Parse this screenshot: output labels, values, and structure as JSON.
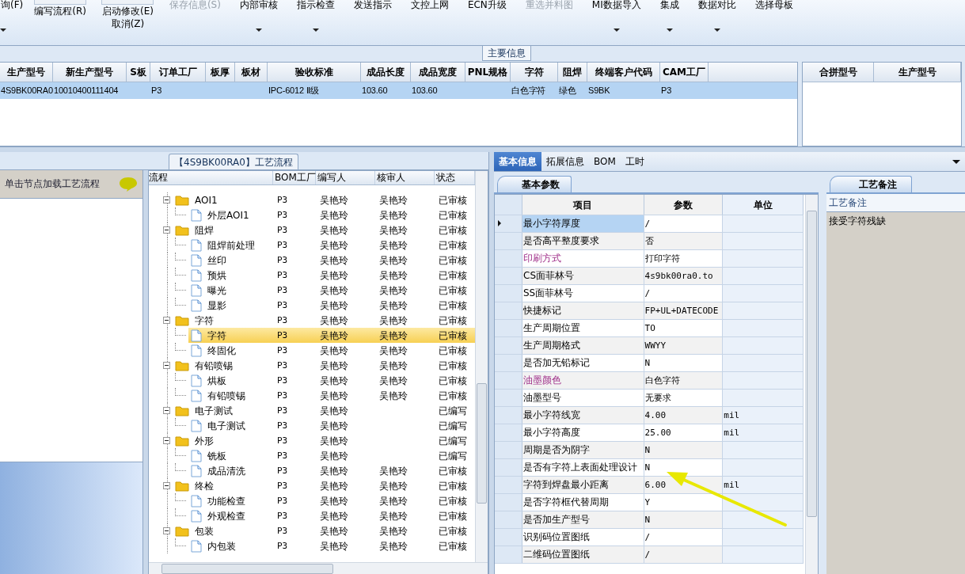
{
  "toolbar": {
    "left_items": [
      {
        "label": "询(F)",
        "dropdown": true
      }
    ],
    "stacked": [
      {
        "label": "编写流程(R)"
      },
      {
        "label": "启动修改(E)",
        "sub": "取消(Z)"
      }
    ],
    "items": [
      {
        "label": "保存信息(S)",
        "disabled": true,
        "dropdown": false
      },
      {
        "label": "内部审核",
        "disabled": false,
        "dropdown": true
      },
      {
        "label": "指示检查",
        "disabled": false,
        "dropdown": true
      },
      {
        "label": "发送指示",
        "disabled": false,
        "dropdown": false
      },
      {
        "label": "文控上网",
        "disabled": false,
        "dropdown": false
      },
      {
        "label": "ECN升级",
        "disabled": false,
        "dropdown": false
      },
      {
        "label": "重选并料图",
        "disabled": true,
        "dropdown": false
      },
      {
        "label": "MI数据导入",
        "disabled": false,
        "dropdown": true
      },
      {
        "label": "集成",
        "disabled": false,
        "dropdown": true
      },
      {
        "label": "数据对比",
        "disabled": false,
        "dropdown": true
      },
      {
        "label": "选择母板",
        "disabled": false,
        "dropdown": false
      }
    ]
  },
  "main_info": {
    "title": "主要信息",
    "columns": [
      "生产型号",
      "新生产型号",
      "S板",
      "订单工厂",
      "板厚",
      "板材",
      "验收标准",
      "成品长度",
      "成品宽度",
      "PNL规格",
      "字符",
      "阻焊",
      "终端客户代码",
      "CAM工厂"
    ],
    "rows": [
      {
        "selected": true,
        "cells": [
          "4S9BK00RA0",
          "10010400111404",
          "",
          "P3",
          "",
          "",
          "IPC-6012 Ⅱ级",
          "103.60",
          "103.60",
          "",
          "白色字符",
          "绿色",
          "S9BK",
          "P3"
        ]
      }
    ],
    "side_columns": [
      "合拼型号",
      "生产型号"
    ]
  },
  "process": {
    "title": "【4S9BK00RA0】工艺流程",
    "hint": "单击节点加载工艺流程",
    "columns": [
      "流程",
      "BOM工厂",
      "编写人",
      "核审人",
      "状态"
    ],
    "tree": [
      {
        "label": "AOI1",
        "bom": "P3",
        "writer": "吴艳玲",
        "reviewer": "吴艳玲",
        "status": "已审核",
        "expanded": true,
        "selected": false,
        "children": [
          {
            "label": "外层AOI1",
            "bom": "P3",
            "writer": "吴艳玲",
            "reviewer": "吴艳玲",
            "status": "已审核",
            "selected": false
          }
        ]
      },
      {
        "label": "阻焊",
        "bom": "P3",
        "writer": "吴艳玲",
        "reviewer": "吴艳玲",
        "status": "已审核",
        "expanded": true,
        "selected": false,
        "children": [
          {
            "label": "阻焊前处理",
            "bom": "P3",
            "writer": "吴艳玲",
            "reviewer": "吴艳玲",
            "status": "已审核",
            "selected": false
          },
          {
            "label": "丝印",
            "bom": "P3",
            "writer": "吴艳玲",
            "reviewer": "吴艳玲",
            "status": "已审核",
            "selected": false
          },
          {
            "label": "预烘",
            "bom": "P3",
            "writer": "吴艳玲",
            "reviewer": "吴艳玲",
            "status": "已审核",
            "selected": false
          },
          {
            "label": "曝光",
            "bom": "P3",
            "writer": "吴艳玲",
            "reviewer": "吴艳玲",
            "status": "已审核",
            "selected": false
          },
          {
            "label": "显影",
            "bom": "P3",
            "writer": "吴艳玲",
            "reviewer": "吴艳玲",
            "status": "已审核",
            "selected": false
          }
        ]
      },
      {
        "label": "字符",
        "bom": "P3",
        "writer": "吴艳玲",
        "reviewer": "吴艳玲",
        "status": "已审核",
        "expanded": true,
        "selected": false,
        "children": [
          {
            "label": "字符",
            "bom": "P3",
            "writer": "吴艳玲",
            "reviewer": "吴艳玲",
            "status": "已审核",
            "selected": true
          },
          {
            "label": "终固化",
            "bom": "P3",
            "writer": "吴艳玲",
            "reviewer": "吴艳玲",
            "status": "已审核",
            "selected": false
          }
        ]
      },
      {
        "label": "有铅喷锡",
        "bom": "P3",
        "writer": "吴艳玲",
        "reviewer": "吴艳玲",
        "status": "已审核",
        "expanded": true,
        "selected": false,
        "children": [
          {
            "label": "烘板",
            "bom": "P3",
            "writer": "吴艳玲",
            "reviewer": "吴艳玲",
            "status": "已审核",
            "selected": false
          },
          {
            "label": "有铅喷锡",
            "bom": "P3",
            "writer": "吴艳玲",
            "reviewer": "吴艳玲",
            "status": "已审核",
            "selected": false
          }
        ]
      },
      {
        "label": "电子测试",
        "bom": "P3",
        "writer": "吴艳玲",
        "status": "已编写",
        "expanded": true,
        "selected": false,
        "children": [
          {
            "label": "电子测试",
            "bom": "P3",
            "writer": "吴艳玲",
            "status": "已编写",
            "selected": false
          }
        ]
      },
      {
        "label": "外形",
        "bom": "P3",
        "writer": "吴艳玲",
        "status": "已编写",
        "expanded": true,
        "selected": false,
        "children": [
          {
            "label": "铣板",
            "bom": "P3",
            "writer": "吴艳玲",
            "status": "已编写",
            "selected": false
          },
          {
            "label": "成品清洗",
            "bom": "P3",
            "writer": "吴艳玲",
            "reviewer": "吴艳玲",
            "status": "已审核",
            "selected": false
          }
        ]
      },
      {
        "label": "终检",
        "bom": "P3",
        "writer": "吴艳玲",
        "reviewer": "吴艳玲",
        "status": "已审核",
        "expanded": true,
        "selected": false,
        "children": [
          {
            "label": "功能检查",
            "bom": "P3",
            "writer": "吴艳玲",
            "reviewer": "吴艳玲",
            "status": "已审核",
            "selected": false
          },
          {
            "label": "外观检查",
            "bom": "P3",
            "writer": "吴艳玲",
            "reviewer": "吴艳玲",
            "status": "已审核",
            "selected": false
          }
        ]
      },
      {
        "label": "包装",
        "bom": "P3",
        "writer": "吴艳玲",
        "reviewer": "吴艳玲",
        "status": "已审核",
        "expanded": true,
        "selected": false,
        "children": [
          {
            "label": "内包装",
            "bom": "P3",
            "writer": "吴艳玲",
            "reviewer": "吴艳玲",
            "status": "已审核",
            "selected": false
          }
        ]
      }
    ]
  },
  "detail_tabs": [
    {
      "label": "基本信息",
      "selected": true
    },
    {
      "label": "拓展信息",
      "selected": false
    },
    {
      "label": "BOM",
      "selected": false
    },
    {
      "label": "工时",
      "selected": false
    }
  ],
  "params": {
    "tab": "基本参数",
    "columns": [
      "项目",
      "参数",
      "单位"
    ],
    "rows": [
      {
        "item": "最小字符厚度",
        "value": "/",
        "unit": "",
        "highlighted": false,
        "selected": true
      },
      {
        "item": "是否高平整度要求",
        "value": "否",
        "unit": "",
        "highlighted": false,
        "selected": false
      },
      {
        "item": "印刷方式",
        "value": "打印字符",
        "unit": "",
        "highlighted": true,
        "selected": false
      },
      {
        "item": "CS面菲林号",
        "value": "4s9bk00ra0.to",
        "unit": "",
        "highlighted": false,
        "selected": false
      },
      {
        "item": "SS面菲林号",
        "value": "/",
        "unit": "",
        "highlighted": false,
        "selected": false
      },
      {
        "item": "快捷标记",
        "value": "FP+UL+DATECODE",
        "unit": "",
        "highlighted": false,
        "selected": false
      },
      {
        "item": "生产周期位置",
        "value": "TO",
        "unit": "",
        "highlighted": false,
        "selected": false
      },
      {
        "item": "生产周期格式",
        "value": "WWYY",
        "unit": "",
        "highlighted": false,
        "selected": false
      },
      {
        "item": "是否加无铅标记",
        "value": "N",
        "unit": "",
        "highlighted": false,
        "selected": false
      },
      {
        "item": "油墨颜色",
        "value": "白色字符",
        "unit": "",
        "highlighted": true,
        "selected": false
      },
      {
        "item": "油墨型号",
        "value": "无要求",
        "unit": "",
        "highlighted": false,
        "selected": false
      },
      {
        "item": "最小字符线宽",
        "value": "4.00",
        "unit": "mil",
        "highlighted": false,
        "selected": false
      },
      {
        "item": "最小字符高度",
        "value": "25.00",
        "unit": "mil",
        "highlighted": false,
        "selected": false
      },
      {
        "item": "周期是否为阴字",
        "value": "N",
        "unit": "",
        "highlighted": false,
        "selected": false
      },
      {
        "item": "是否有字符上表面处理设计",
        "value": "N",
        "unit": "",
        "highlighted": false,
        "selected": false
      },
      {
        "item": "字符到焊盘最小距离",
        "value": "6.00",
        "unit": "mil",
        "highlighted": false,
        "selected": false
      },
      {
        "item": "是否字符框代替周期",
        "value": "Y",
        "unit": "",
        "highlighted": false,
        "selected": false
      },
      {
        "item": "是否加生产型号",
        "value": "N",
        "unit": "",
        "highlighted": false,
        "selected": false
      },
      {
        "item": "识别码位置图纸",
        "value": "/",
        "unit": "",
        "highlighted": false,
        "selected": false
      },
      {
        "item": "二维码位置图纸",
        "value": "/",
        "unit": "",
        "highlighted": false,
        "selected": false
      }
    ]
  },
  "remarks": {
    "tab": "工艺备注",
    "header": "工艺备注",
    "text": "接受字符残缺"
  }
}
